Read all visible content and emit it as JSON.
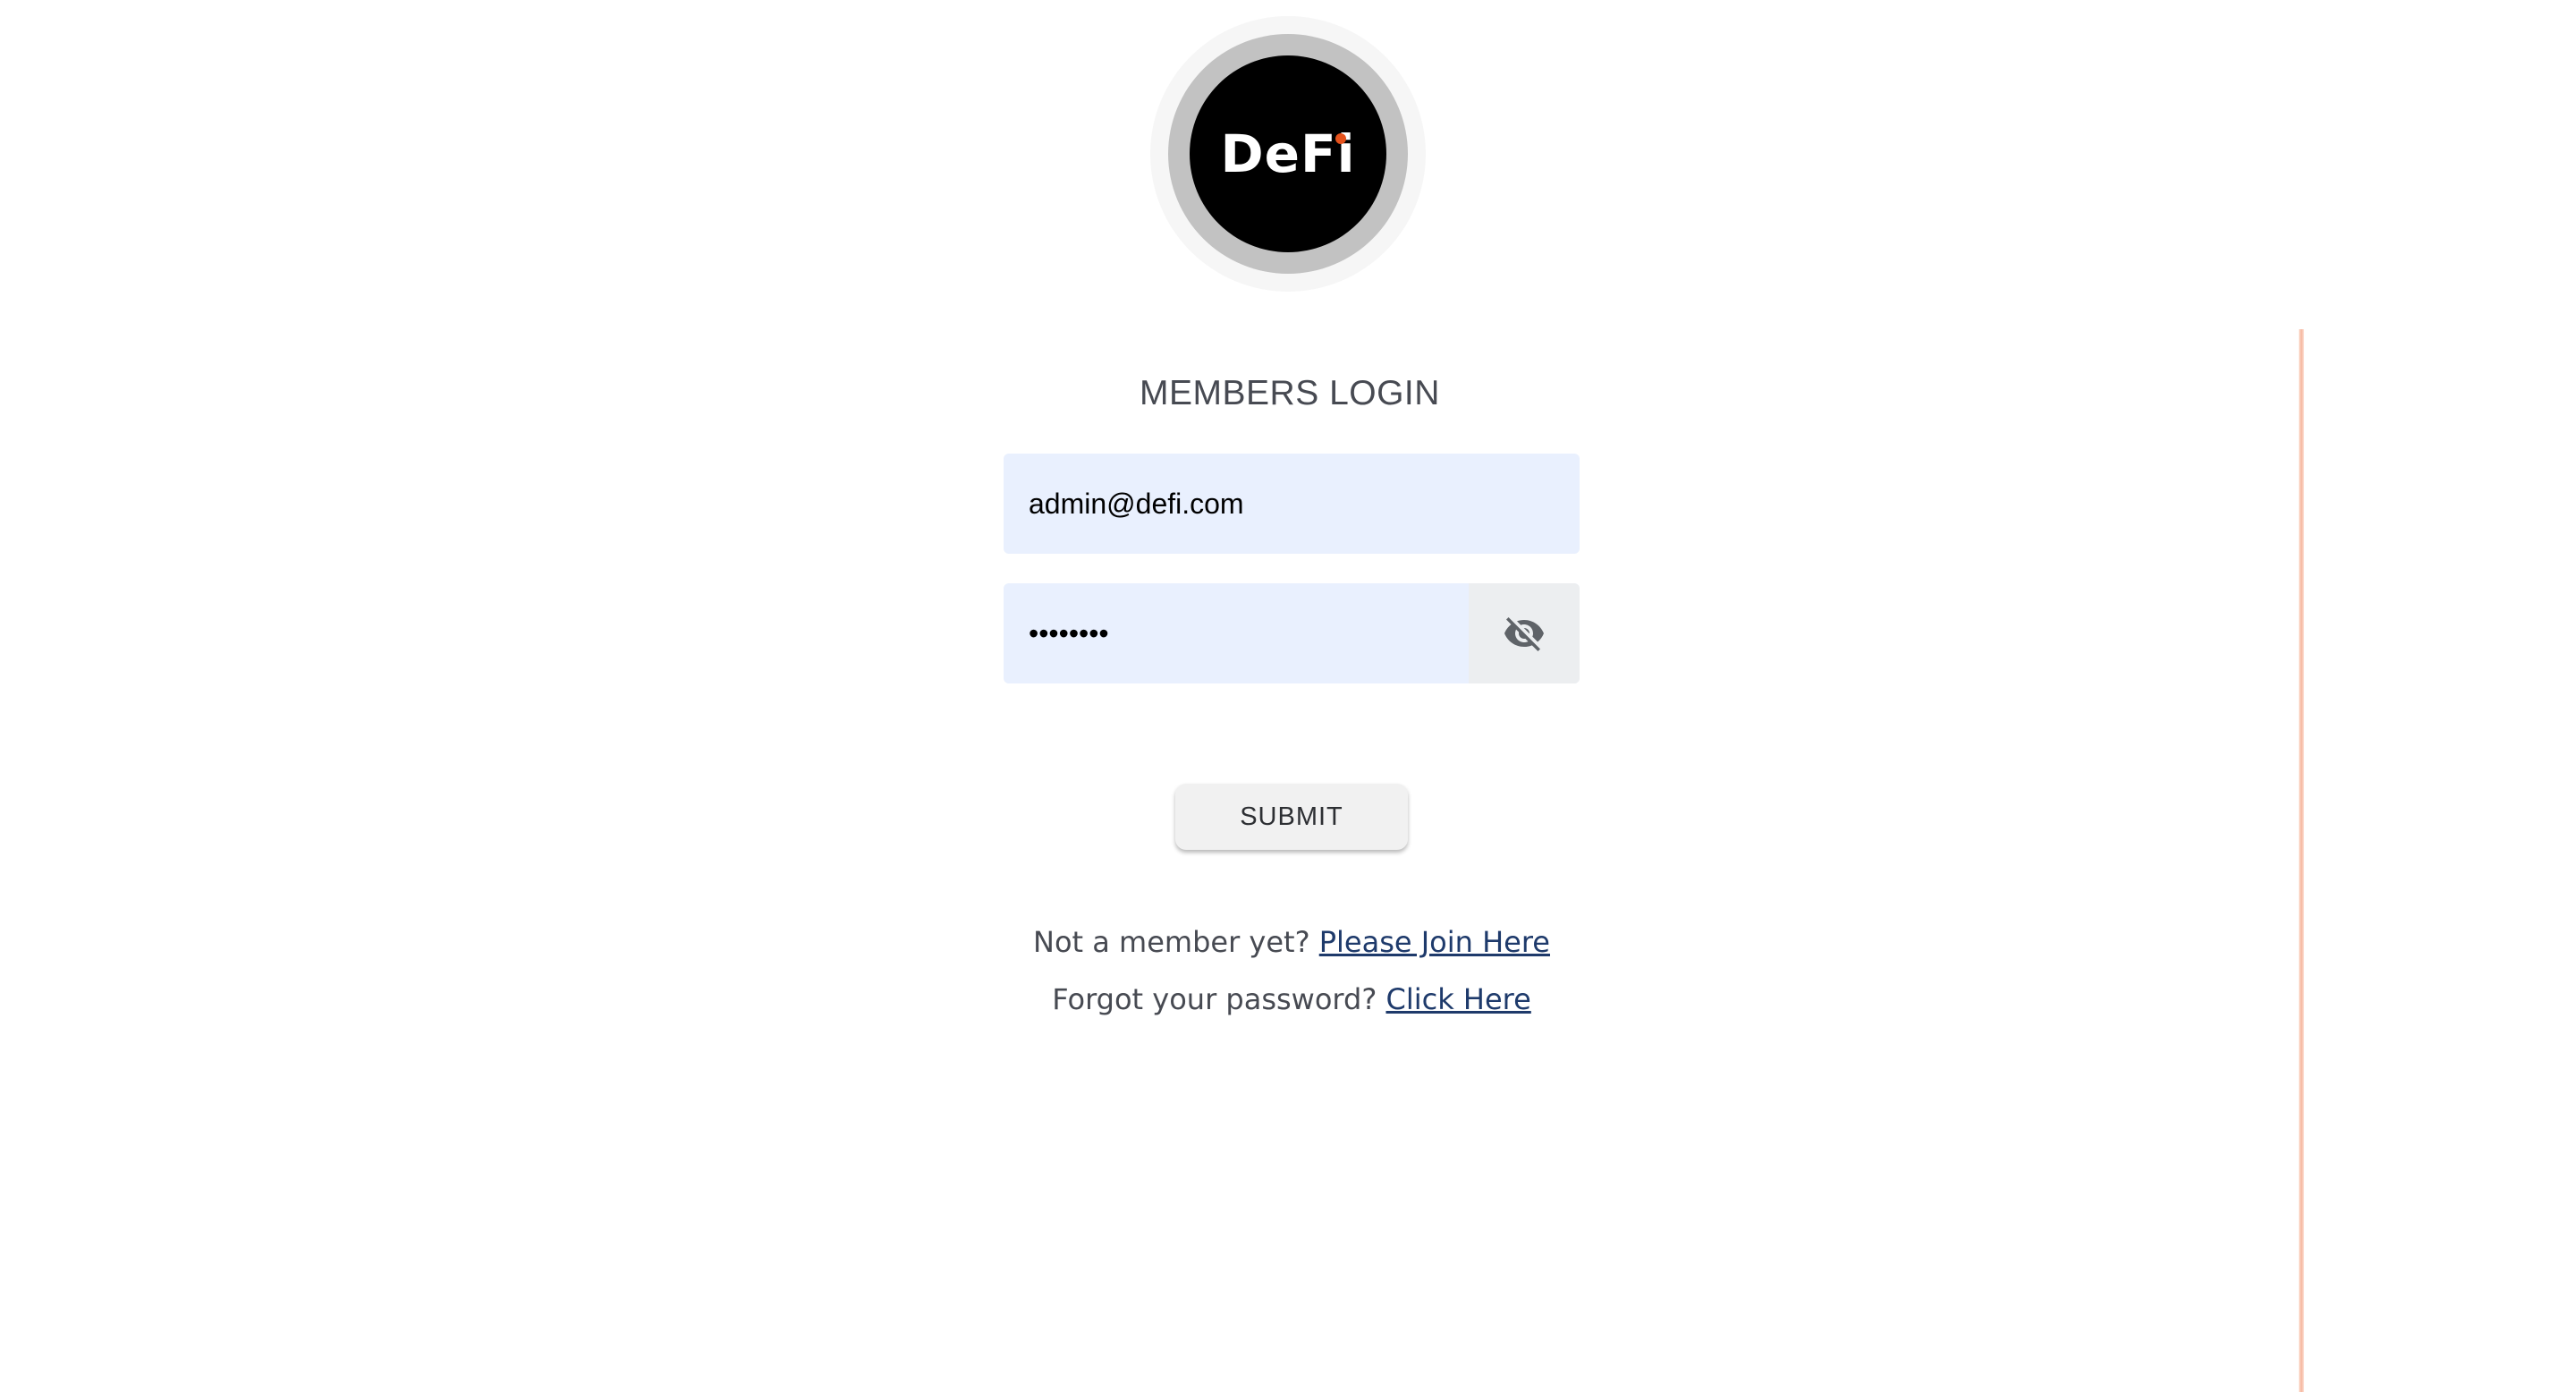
{
  "logo": {
    "text": "DeFi",
    "accent_color": "#e5521c"
  },
  "login": {
    "title": "MEMBERS LOGIN",
    "email_value": "admin@defi.com",
    "password_value": "••••••••",
    "password_toggle_icon": "eye-off-icon",
    "submit_label": "SUBMIT"
  },
  "footer": {
    "join_prompt": "Not a member yet?",
    "join_link": "Please Join Here",
    "forgot_prompt": "Forgot your password?",
    "forgot_link": "Click Here"
  },
  "colors": {
    "input_background": "#e9f0fe",
    "link": "#1e3a6b",
    "text": "#474a52"
  }
}
